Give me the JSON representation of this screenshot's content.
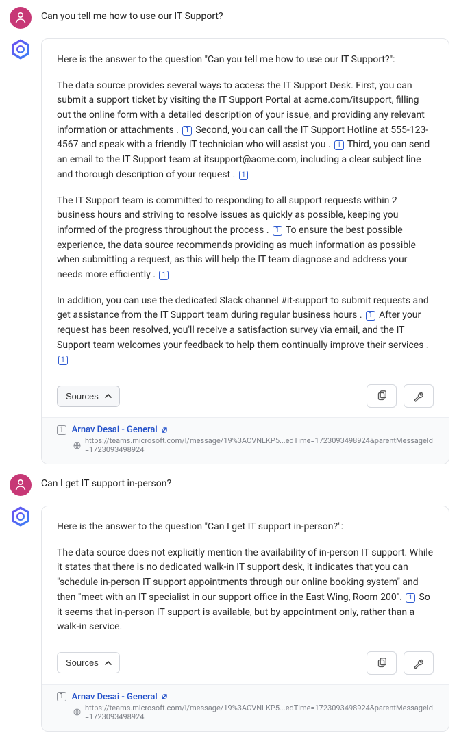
{
  "citationLabel": "1",
  "thread": [
    {
      "role": "user",
      "text": "Can you tell me how to use our IT Support?"
    },
    {
      "role": "bot",
      "intro": "Here is the answer to the question \"Can you tell me how to use our IT Support?\":",
      "p1a": "The data source provides several ways to access the IT Support Desk. First, you can submit a support ticket by visiting the IT Support Portal at acme.com/itsupport, filling out the online form with a detailed description of your issue, and providing any relevant information or attachments . ",
      "p1b": " Second, you can call the IT Support Hotline at 555-123-4567 and speak with a friendly IT technician who will assist you . ",
      "p1c": " Third, you can send an email to the IT Support team at itsupport@acme.com, including a clear subject line and thorough description of your request . ",
      "p2a": "The IT Support team is committed to responding to all support requests within 2 business hours and striving to resolve issues as quickly as possible, keeping you informed of the progress throughout the process . ",
      "p2b": " To ensure the best possible experience, the data source recommends providing as much information as possible when submitting a request, as this will help the IT team diagnose and address your needs more efficiently . ",
      "p3a": "In addition, you can use the dedicated Slack channel #it-support to submit requests and get assistance from the IT Support team during regular business hours . ",
      "p3b": " After your request has been resolved, you'll receive a satisfaction survey via email, and the IT Support team welcomes your feedback to help them continually improve their services . ",
      "sourcesLabel": "Sources",
      "sourcesExpanded": true,
      "source": {
        "badge": "1",
        "title": "Arnav Desai - General",
        "url": "https://teams.microsoft.com/l/message/19%3ACVNLKP5...edTime=1723093498924&parentMessageId=1723093498924"
      }
    },
    {
      "role": "user",
      "text": "Can I get IT support in-person?"
    },
    {
      "role": "bot",
      "intro": "Here is the answer to the question \"Can I get IT support in-person?\":",
      "p1a": "The data source does not explicitly mention the availability of in-person IT support. While it states that there is no dedicated walk-in IT support desk, it indicates that you can \"schedule in-person IT support appointments through our online booking system\" and then \"meet with an IT specialist in our support office in the East Wing, Room 200\". ",
      "p1b": " So it seems that in-person IT support is available, but by appointment only, rather than a walk-in service.",
      "sourcesLabel": "Sources",
      "sourcesExpanded": false,
      "source": {
        "badge": "1",
        "title": "Arnav Desai - General",
        "url": "https://teams.microsoft.com/l/message/19%3ACVNLKP5...edTime=1723093498924&parentMessageId=1723093498924"
      }
    }
  ]
}
